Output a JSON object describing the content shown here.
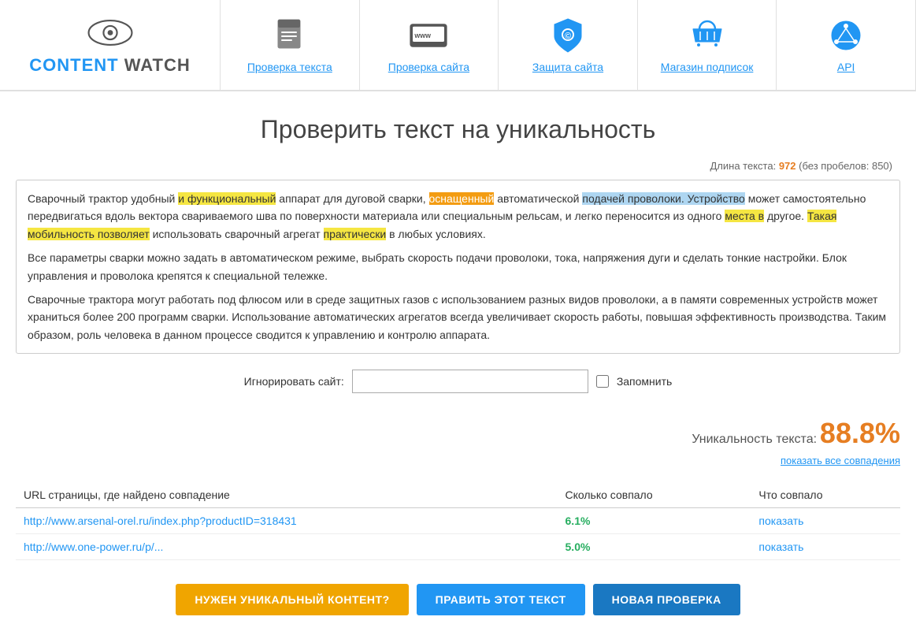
{
  "header": {
    "logo": {
      "content_text": "CONTENT",
      "watch_text": " WATCH",
      "icon_label": "eye-logo"
    },
    "nav": [
      {
        "label": "Проверка текста",
        "icon": "document-icon",
        "id": "nav-check-text"
      },
      {
        "label": "Проверка сайта",
        "icon": "www-icon",
        "id": "nav-check-site"
      },
      {
        "label": "Защита сайта",
        "icon": "shield-icon",
        "id": "nav-protect-site"
      },
      {
        "label": "Магазин подписок",
        "icon": "basket-icon",
        "id": "nav-shop"
      },
      {
        "label": "API",
        "icon": "api-icon",
        "id": "nav-api"
      }
    ]
  },
  "page": {
    "title": "Проверить текст на уникальность",
    "text_length_label": "Длина текста:",
    "text_length_value": "972",
    "no_spaces_label": "(без пробелов:",
    "no_spaces_value": "850)"
  },
  "text_content": {
    "paragraph1": "Сварочный трактор удобный ",
    "p1_h1": "и функциональный",
    "p1_cont1": " аппарат для дуговой сварки, ",
    "p1_h2": "оснащенный",
    "p1_cont2": " автоматической ",
    "p1_h3": "подачей проволоки. Устройство",
    "p1_cont3": " может самостоятельно передвигаться вдоль вектора свариваемого шва по поверхности материала или специальным рельсам, и легко переносится из одного ",
    "p1_h4": "места в",
    "p1_cont4": " другое. ",
    "p1_h5": "Такая мобильность позволяет",
    "p1_cont5": " использовать сварочный агрегат ",
    "p1_h6": "практически",
    "p1_cont6": " в любых условиях.",
    "paragraph2": "Все параметры сварки можно задать в автоматическом режиме, выбрать скорость подачи проволоки, тока, напряжения дуги и сделать тонкие настройки. Блок управления и проволока крепятся к специальной тележке.",
    "paragraph3": "Сварочные трактора могут работать под флюсом или в среде защитных газов с использованием разных видов проволоки, а в памяти современных устройств может храниться более 200 программ сварки. Использование автоматических агрегатов всегда увеличивает скорость работы, повышая эффективность производства. Таким образом, роль человека в данном процессе сводится к управлению и контролю аппарата."
  },
  "ignore_site": {
    "label": "Игнорировать сайт:",
    "placeholder": "",
    "remember_label": "Запомнить"
  },
  "results": {
    "uniqueness_label": "Уникальность текста:",
    "uniqueness_value": "88.8%",
    "show_all_link": "показать все совпадения",
    "table": {
      "col1": "URL страницы, где найдено совпадение",
      "col2": "Сколько совпало",
      "col3": "Что совпало",
      "rows": [
        {
          "url": "http://www.arsenal-orel.ru/index.php?productID=318431",
          "percent": "6.1%",
          "action": "показать"
        },
        {
          "url": "http://www.one-power.ru/p/...",
          "percent": "5.0%",
          "action": "показать"
        }
      ]
    }
  },
  "buttons": {
    "need_unique": "НУЖЕН УНИКАЛЬНЫЙ КОНТЕНТ?",
    "edit_text": "ПРАВИТЬ ЭТОТ ТЕКСТ",
    "new_check": "НОВАЯ ПРОВЕРКА"
  }
}
